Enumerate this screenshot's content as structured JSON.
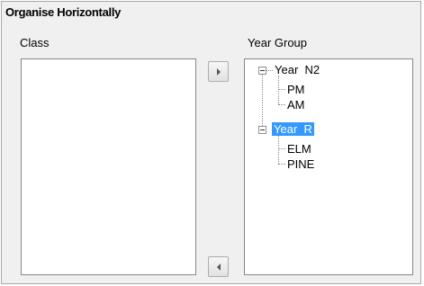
{
  "panel": {
    "title": "Organise Horizontally"
  },
  "class_list": {
    "label": "Class",
    "items": []
  },
  "year_group": {
    "label": "Year Group",
    "tree": [
      {
        "label": "Year  N2",
        "expanded": true,
        "children": [
          "PM",
          "AM"
        ]
      },
      {
        "label": "Year  R",
        "expanded": true,
        "selected": true,
        "children": [
          "ELM",
          "PINE"
        ]
      }
    ]
  },
  "buttons": {
    "move_right_icon": "triangle-right-icon",
    "move_left_icon": "triangle-left-icon"
  },
  "colors": {
    "selection": "#3399ff",
    "panel_background": "#f0f0f0"
  }
}
